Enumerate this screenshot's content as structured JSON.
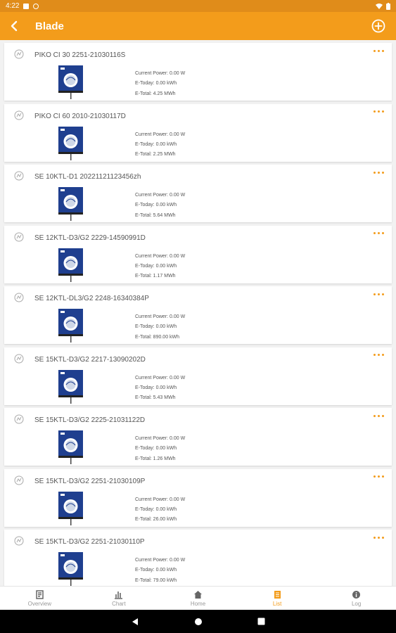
{
  "status_bar": {
    "time": "4:22"
  },
  "header": {
    "title": "Blade"
  },
  "devices": [
    {
      "name": "PIKO CI 30 2251-21030116S",
      "current_power": "Current Power: 0.00 W",
      "e_today": "E-Today: 0.00 kWh",
      "e_total": "E-Total: 4.25 MWh"
    },
    {
      "name": "PIKO CI 60 2010-21030117D",
      "current_power": "Current Power: 0.00 W",
      "e_today": "E-Today: 0.00 kWh",
      "e_total": "E-Total: 2.25 MWh"
    },
    {
      "name": "SE 10KTL-D1 20221121123456zh",
      "current_power": "Current Power: 0.00 W",
      "e_today": "E-Today: 0.00 kWh",
      "e_total": "E-Total: 5.64 MWh"
    },
    {
      "name": "SE 12KTL-D3/G2 2229-14590991D",
      "current_power": "Current Power: 0.00 W",
      "e_today": "E-Today: 0.00 kWh",
      "e_total": "E-Total: 1.17 MWh"
    },
    {
      "name": "SE 12KTL-DL3/G2 2248-16340384P",
      "current_power": "Current Power: 0.00 W",
      "e_today": "E-Today: 0.00 kWh",
      "e_total": "E-Total: 890.00 kWh"
    },
    {
      "name": "SE 15KTL-D3/G2 2217-13090202D",
      "current_power": "Current Power: 0.00 W",
      "e_today": "E-Today: 0.00 kWh",
      "e_total": "E-Total: 5.43 MWh"
    },
    {
      "name": "SE 15KTL-D3/G2 2225-21031122D",
      "current_power": "Current Power: 0.00 W",
      "e_today": "E-Today: 0.00 kWh",
      "e_total": "E-Total: 1.26 MWh"
    },
    {
      "name": "SE 15KTL-D3/G2 2251-21030109P",
      "current_power": "Current Power: 0.00 W",
      "e_today": "E-Today: 0.00 kWh",
      "e_total": "E-Total: 26.00 kWh"
    },
    {
      "name": "SE 15KTL-D3/G2 2251-21030110P",
      "current_power": "Current Power: 0.00 W",
      "e_today": "E-Today: 0.00 kWh",
      "e_total": "E-Total: 79.00 kWh"
    }
  ],
  "tabs": [
    {
      "label": "Overview",
      "icon": "overview-icon",
      "active": false
    },
    {
      "label": "Chart",
      "icon": "chart-icon",
      "active": false
    },
    {
      "label": "Home",
      "icon": "home-icon",
      "active": false
    },
    {
      "label": "List",
      "icon": "list-icon",
      "active": true
    },
    {
      "label": "Log",
      "icon": "log-icon",
      "active": false
    }
  ],
  "colors": {
    "accent": "#f39c1b",
    "status_bar": "#e08c1a",
    "inverter_blue": "#1f3f8f"
  }
}
